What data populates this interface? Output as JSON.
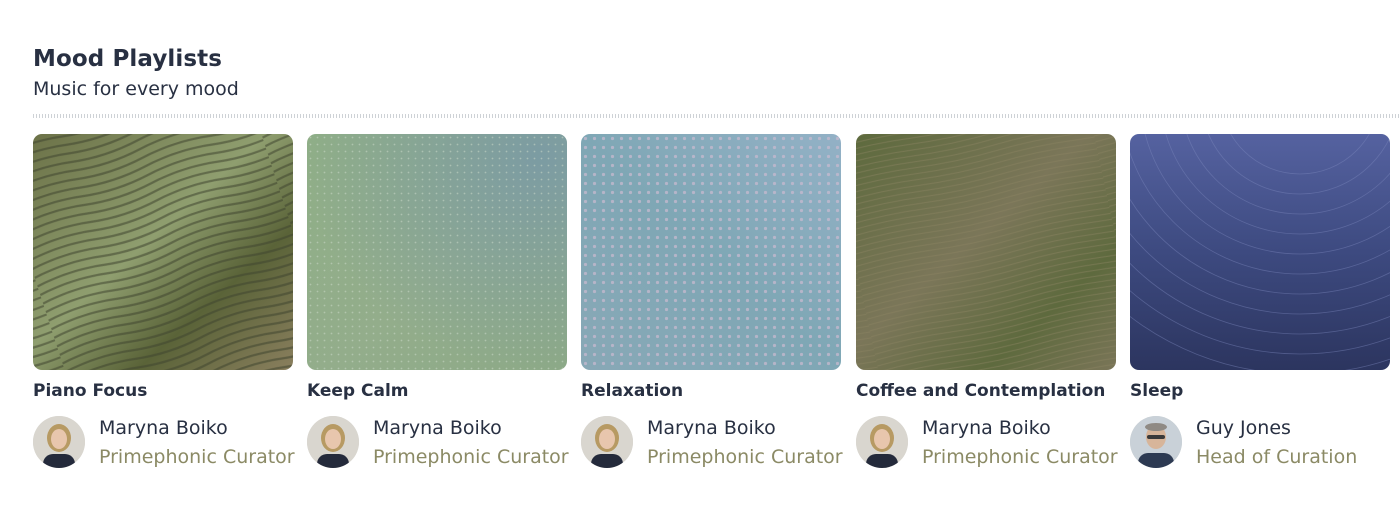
{
  "section": {
    "title": "Mood Playlists",
    "subtitle": "Music for every mood"
  },
  "playlists": [
    {
      "title": "Piano Focus",
      "curator_name": "Maryna Boiko",
      "curator_role": "Primephonic Curator",
      "colors": [
        "#96a882",
        "#646b45",
        "#7a7456"
      ]
    },
    {
      "title": "Keep Calm",
      "curator_name": "Maryna Boiko",
      "curator_role": "Primephonic Curator",
      "colors": [
        "#8fac88",
        "#7f9da6",
        "#94ab8a"
      ]
    },
    {
      "title": "Relaxation",
      "curator_name": "Maryna Boiko",
      "curator_role": "Primephonic Curator",
      "colors": [
        "#8aaabb",
        "#82a8b4",
        "#95b4c0"
      ]
    },
    {
      "title": "Coffee and Contemplation",
      "curator_name": "Maryna Boiko",
      "curator_role": "Primephonic Curator",
      "colors": [
        "#5f6b3f",
        "#7b7659",
        "#77725a"
      ]
    },
    {
      "title": "Sleep",
      "curator_name": "Guy Jones",
      "curator_role": "Head of Curation",
      "colors": [
        "#4d5a95",
        "#3a4678",
        "#2f3763"
      ]
    }
  ]
}
